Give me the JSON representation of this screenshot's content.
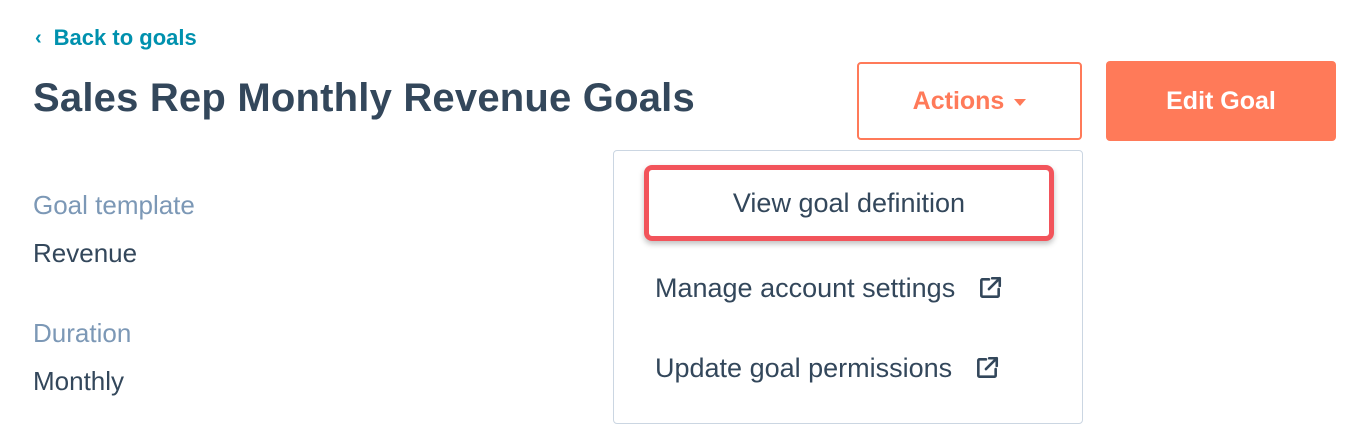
{
  "nav": {
    "back_label": "Back to goals",
    "back_icon": "chevron-left-icon"
  },
  "header": {
    "title": "Sales Rep Monthly Revenue Goals",
    "actions_label": "Actions",
    "edit_label": "Edit Goal"
  },
  "details": {
    "goal_template_label": "Goal template",
    "goal_template_value": "Revenue",
    "duration_label": "Duration",
    "duration_value": "Monthly"
  },
  "actions_menu": {
    "items": [
      {
        "label": "View goal definition",
        "external": false,
        "highlighted": true
      },
      {
        "label": "Manage account settings",
        "external": true,
        "icon": "external-link-icon"
      },
      {
        "label": "Update goal permissions",
        "external": true,
        "icon": "external-link-icon"
      }
    ]
  },
  "colors": {
    "accent": "#ff7a59",
    "link": "#0091ae",
    "highlight_border": "#f2545b",
    "text": "#33475b",
    "label": "#7c98b6"
  }
}
